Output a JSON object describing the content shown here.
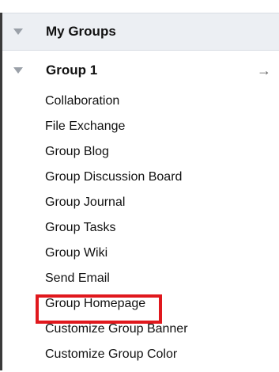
{
  "sidebar": {
    "section_title": "My Groups",
    "group": {
      "name": "Group 1",
      "arrow_glyph": "→"
    },
    "tools": [
      "Collaboration",
      "File Exchange",
      "Group Blog",
      "Group Discussion Board",
      "Group Journal",
      "Group Tasks",
      "Group Wiki",
      "Send Email",
      "Group Homepage",
      "Customize Group Banner",
      "Customize Group Color"
    ]
  },
  "highlight": {
    "target": "Group Homepage",
    "color": "#e0181d"
  },
  "colors": {
    "header_background": "#eceff3",
    "triangle": "#9aa0a8",
    "left_border": "#3a3a3a"
  }
}
